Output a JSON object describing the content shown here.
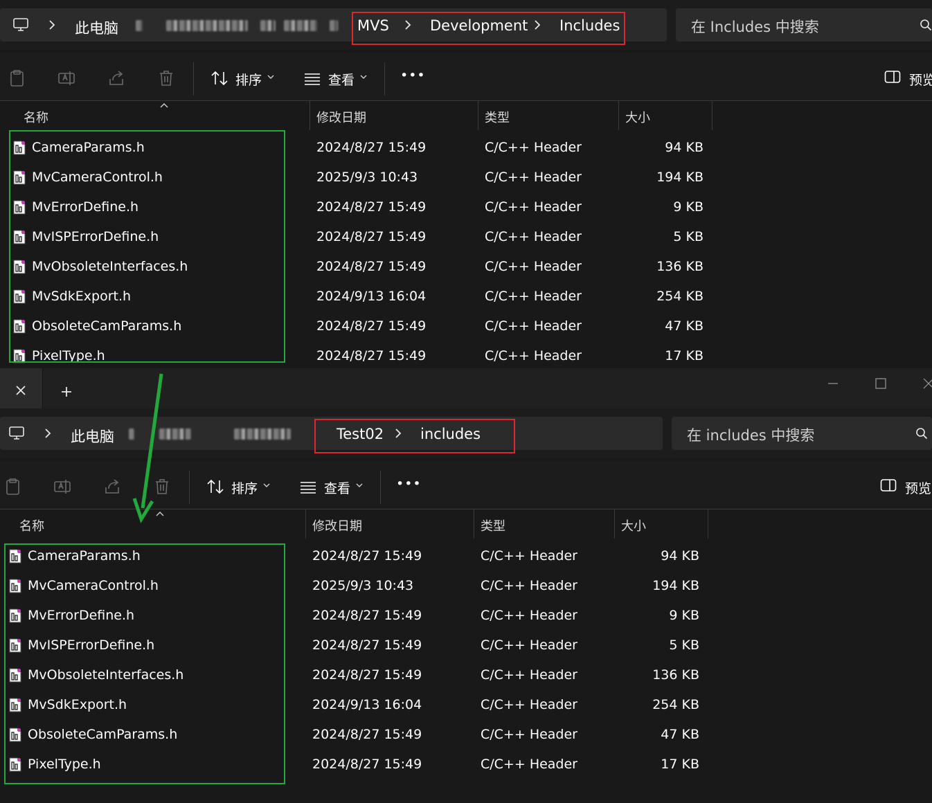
{
  "colors": {
    "red_highlight": "#e0252f",
    "green_highlight": "#22a83c",
    "arrow": "#22a83c"
  },
  "top_window": {
    "breadcrumb": {
      "root": "此电脑",
      "items": [
        "MVS",
        "Development",
        "Includes"
      ]
    },
    "search": {
      "placeholder": "在 Includes 中搜索"
    },
    "toolbar": {
      "sort": "排序",
      "view": "查看",
      "more": "•••",
      "preview": "预览"
    },
    "columns": {
      "name": "名称",
      "date": "修改日期",
      "type": "类型",
      "size": "大小"
    },
    "files": [
      {
        "name": "CameraParams.h",
        "date": "2024/8/27 15:49",
        "type": "C/C++ Header",
        "size": "94 KB"
      },
      {
        "name": "MvCameraControl.h",
        "date": "2025/9/3 10:43",
        "type": "C/C++ Header",
        "size": "194 KB"
      },
      {
        "name": "MvErrorDefine.h",
        "date": "2024/8/27 15:49",
        "type": "C/C++ Header",
        "size": "9 KB"
      },
      {
        "name": "MvISPErrorDefine.h",
        "date": "2024/8/27 15:49",
        "type": "C/C++ Header",
        "size": "5 KB"
      },
      {
        "name": "MvObsoleteInterfaces.h",
        "date": "2024/8/27 15:49",
        "type": "C/C++ Header",
        "size": "136 KB"
      },
      {
        "name": "MvSdkExport.h",
        "date": "2024/9/13 16:04",
        "type": "C/C++ Header",
        "size": "254 KB"
      },
      {
        "name": "ObsoleteCamParams.h",
        "date": "2024/8/27 15:49",
        "type": "C/C++ Header",
        "size": "47 KB"
      },
      {
        "name": "PixelType.h",
        "date": "2024/8/27 15:49",
        "type": "C/C++ Header",
        "size": "17 KB"
      }
    ]
  },
  "bottom_window": {
    "breadcrumb": {
      "root": "此电脑",
      "items": [
        "Test02",
        "includes"
      ]
    },
    "search": {
      "placeholder": "在 includes 中搜索"
    },
    "toolbar": {
      "sort": "排序",
      "view": "查看",
      "more": "•••",
      "preview": "预览"
    },
    "columns": {
      "name": "名称",
      "date": "修改日期",
      "type": "类型",
      "size": "大小"
    },
    "files": [
      {
        "name": "CameraParams.h",
        "date": "2024/8/27 15:49",
        "type": "C/C++ Header",
        "size": "94 KB"
      },
      {
        "name": "MvCameraControl.h",
        "date": "2025/9/3 10:43",
        "type": "C/C++ Header",
        "size": "194 KB"
      },
      {
        "name": "MvErrorDefine.h",
        "date": "2024/8/27 15:49",
        "type": "C/C++ Header",
        "size": "9 KB"
      },
      {
        "name": "MvISPErrorDefine.h",
        "date": "2024/8/27 15:49",
        "type": "C/C++ Header",
        "size": "5 KB"
      },
      {
        "name": "MvObsoleteInterfaces.h",
        "date": "2024/8/27 15:49",
        "type": "C/C++ Header",
        "size": "136 KB"
      },
      {
        "name": "MvSdkExport.h",
        "date": "2024/9/13 16:04",
        "type": "C/C++ Header",
        "size": "254 KB"
      },
      {
        "name": "ObsoleteCamParams.h",
        "date": "2024/8/27 15:49",
        "type": "C/C++ Header",
        "size": "47 KB"
      },
      {
        "name": "PixelType.h",
        "date": "2024/8/27 15:49",
        "type": "C/C++ Header",
        "size": "17 KB"
      }
    ]
  }
}
